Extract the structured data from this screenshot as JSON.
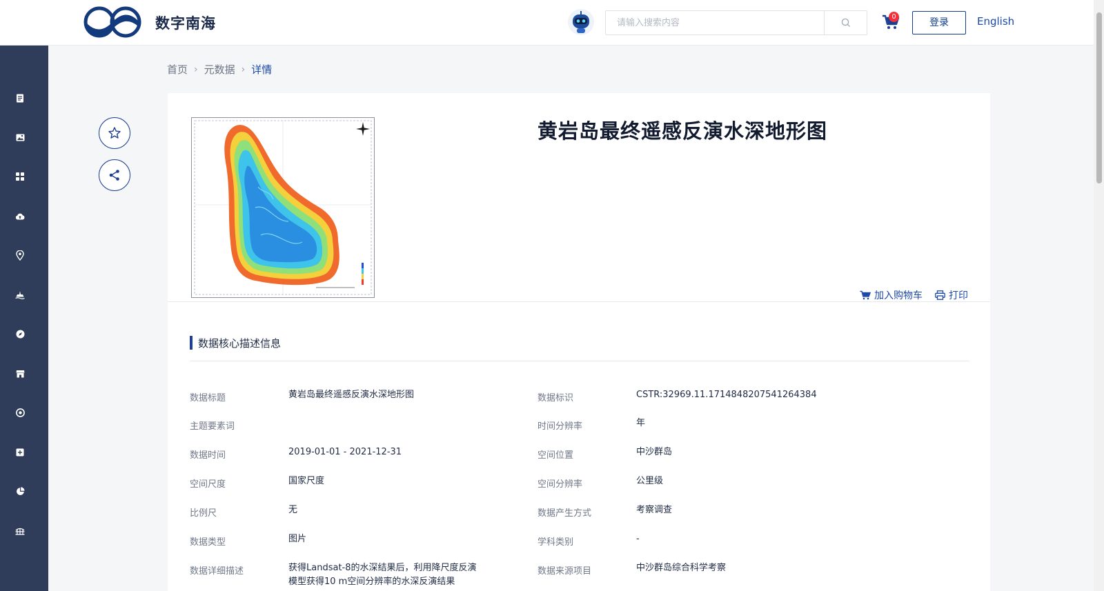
{
  "header": {
    "site_name": "数字南海",
    "search_placeholder": "请输入搜索内容",
    "cart_count": "0",
    "login_label": "登录",
    "language_link": "English"
  },
  "sidebar": {
    "icons": [
      "document-icon",
      "image-icon",
      "grid-icon",
      "cloud-upload-icon",
      "location-pin-icon",
      "ship-icon",
      "compass-icon",
      "storefront-icon",
      "target-icon",
      "add-box-icon",
      "pie-chart-icon",
      "bridge-icon"
    ]
  },
  "breadcrumb": {
    "home": "首页",
    "metadata": "元数据",
    "current": "详情"
  },
  "detail": {
    "title": "黄岩岛最终遥感反演水深地形图",
    "add_cart_label": "加入购物车",
    "print_label": "打印"
  },
  "section": {
    "title": "数据核心描述信息"
  },
  "fields": [
    {
      "label": "数据标题",
      "value": "黄岩岛最终遥感反演水深地形图"
    },
    {
      "label": "数据标识",
      "value": "CSTR:32969.11.1714848207541264384"
    },
    {
      "label": "主题要素词",
      "value": ""
    },
    {
      "label": "时间分辨率",
      "value": "年"
    },
    {
      "label": "数据时间",
      "value": "2019-01-01 - 2021-12-31"
    },
    {
      "label": "空间位置",
      "value": "中沙群岛"
    },
    {
      "label": "空间尺度",
      "value": "国家尺度"
    },
    {
      "label": "空间分辨率",
      "value": "公里级"
    },
    {
      "label": "比例尺",
      "value": "无"
    },
    {
      "label": "数据产生方式",
      "value": "考察调查"
    },
    {
      "label": "数据类型",
      "value": "图片"
    },
    {
      "label": "学科类别",
      "value": "-"
    },
    {
      "label": "数据详细描述",
      "value": "获得Landsat-8的水深结果后，利用降尺度反演模型获得10 m空间分辨率的水深反演结果"
    },
    {
      "label": "数据来源项目",
      "value": "中沙群岛综合科学考察"
    }
  ],
  "colors": {
    "sidebar_bg": "#2f3d5a",
    "accent": "#1c48a8",
    "badge": "#f5303a"
  }
}
